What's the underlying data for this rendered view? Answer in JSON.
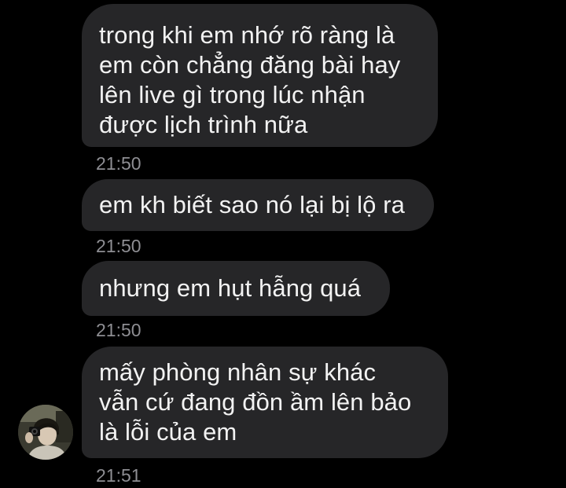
{
  "messages": [
    {
      "text": "trong khi em nhớ rõ ràng là\nem còn chẳng đăng bài hay\nlên live gì trong lúc nhận\nđược lịch trình nữa",
      "time": "21:50"
    },
    {
      "text": "em kh biết sao nó lại bị lộ ra",
      "time": "21:50"
    },
    {
      "text": "nhưng em hụt hẫng quá",
      "time": "21:50"
    },
    {
      "text": "mấy phòng nhân sự khác\nvẫn cứ đang đồn ầm lên bảo\nlà lỗi của em",
      "time": "21:51"
    }
  ],
  "colors": {
    "background": "#000000",
    "bubble": "#262628",
    "text": "#f2f2f2",
    "timestamp": "#8e8e93"
  },
  "avatar": {
    "icon": "profile-photo"
  }
}
